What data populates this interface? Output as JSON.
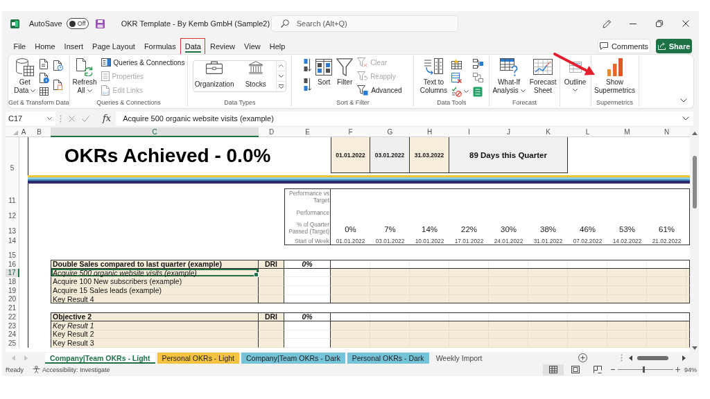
{
  "title_bar": {
    "autosave_label": "AutoSave",
    "autosave": {
      "label": "Off",
      "on": false
    },
    "document_title": "OKR Template - By Kemb GmbH (Sample2)",
    "search": {
      "placeholder": "Search (Alt+Q)"
    }
  },
  "menu": {
    "tabs": [
      {
        "label": "File",
        "selected": false,
        "outlined": false
      },
      {
        "label": "Home",
        "selected": false,
        "outlined": false
      },
      {
        "label": "Insert",
        "selected": false,
        "outlined": false
      },
      {
        "label": "Page Layout",
        "selected": false,
        "outlined": false
      },
      {
        "label": "Formulas",
        "selected": false,
        "outlined": false
      },
      {
        "label": "Data",
        "selected": true,
        "outlined": true
      },
      {
        "label": "Review",
        "selected": false,
        "outlined": false
      },
      {
        "label": "View",
        "selected": false,
        "outlined": false
      },
      {
        "label": "Help",
        "selected": false,
        "outlined": false
      }
    ],
    "comments": "Comments",
    "share": "Share"
  },
  "ribbon": {
    "pointer_arrow": true,
    "groups": [
      {
        "label": "Get & Transform Data",
        "columns": [
          [
            {
              "kind": "large",
              "label": "Get\nData",
              "dropdown": true
            }
          ],
          [
            {
              "kind": "icon"
            },
            {
              "kind": "icon"
            },
            {
              "kind": "icon"
            }
          ],
          [
            {
              "kind": "icon"
            },
            {
              "kind": "icon"
            }
          ]
        ]
      },
      {
        "label": "Queries & Connections",
        "columns": [
          [
            {
              "kind": "large",
              "label": "Refresh\nAll",
              "dropdown": true
            }
          ],
          [
            {
              "kind": "small",
              "label": "Queries & Connections",
              "disabled": false
            },
            {
              "kind": "small",
              "label": "Properties",
              "disabled": true
            },
            {
              "kind": "small",
              "label": "Edit Links",
              "disabled": true
            }
          ]
        ]
      },
      {
        "label": "Data Types",
        "columns": [
          [
            {
              "kind": "gallery",
              "items": [
                "Organization",
                "Stocks"
              ]
            }
          ]
        ]
      },
      {
        "label": "Sort & Filter",
        "columns": [
          [
            {
              "kind": "icon"
            },
            {
              "kind": "icon"
            }
          ],
          [
            {
              "kind": "large",
              "label": "Sort"
            }
          ],
          [
            {
              "kind": "large",
              "label": "Filter"
            }
          ],
          [
            {
              "kind": "small",
              "label": "Clear",
              "disabled": true
            },
            {
              "kind": "small",
              "label": "Reapply",
              "disabled": true
            },
            {
              "kind": "small",
              "label": "Advanced",
              "disabled": false
            }
          ]
        ]
      },
      {
        "label": "Data Tools",
        "columns": [
          [
            {
              "kind": "large",
              "label": "Text to\nColumns"
            }
          ],
          [
            {
              "kind": "icon"
            },
            {
              "kind": "icon"
            },
            {
              "kind": "icon",
              "dropdown": true
            }
          ],
          [
            {
              "kind": "icon"
            },
            {
              "kind": "icon"
            },
            {
              "kind": "icon"
            }
          ]
        ]
      },
      {
        "label": "Forecast",
        "columns": [
          [
            {
              "kind": "large",
              "label": "What-If\nAnalysis",
              "dropdown": true
            }
          ],
          [
            {
              "kind": "large",
              "label": "Forecast\nSheet"
            }
          ]
        ]
      },
      {
        "columns": [
          [
            {
              "kind": "large",
              "label": "Outline",
              "dropdown": true
            }
          ]
        ]
      },
      {
        "label": "Supermetrics",
        "columns": [
          [
            {
              "kind": "large",
              "label": "Show\nSupermetrics"
            }
          ]
        ]
      }
    ]
  },
  "formula_bar": {
    "name_box": "C17",
    "function_label": "fx",
    "value": "Acquire 500 organic website visits (example)"
  },
  "sheet": {
    "columns": [
      {
        "label": "A",
        "selected": false
      },
      {
        "label": "B",
        "selected": false
      },
      {
        "label": "C",
        "selected": true
      },
      {
        "label": "D",
        "selected": false
      },
      {
        "label": "E",
        "selected": false
      },
      {
        "label": "F",
        "selected": false
      },
      {
        "label": "G",
        "selected": false
      },
      {
        "label": "H",
        "selected": false
      },
      {
        "label": "I",
        "selected": false
      },
      {
        "label": "J",
        "selected": false
      },
      {
        "label": "K",
        "selected": false
      },
      {
        "label": "L",
        "selected": false
      },
      {
        "label": "M",
        "selected": false
      },
      {
        "label": "N",
        "selected": false
      }
    ],
    "rows": [
      {
        "kind": "banner",
        "header": "5",
        "title": "OKRs Achieved - 0.0%",
        "dates": [
          {
            "text": "01.01.2022",
            "color": "#f6eedb"
          },
          {
            "text": "03.01.2022",
            "color": "#efefef"
          },
          {
            "text": "31.03.2022",
            "color": "#f6eedb"
          }
        ],
        "days": "89 Days this Quarter"
      },
      {
        "kind": "divider"
      },
      {
        "kind": "metric",
        "header": "11",
        "label": "Performance vs Target"
      },
      {
        "kind": "metric",
        "header": "12",
        "label": "Performance"
      },
      {
        "kind": "metric",
        "header": "13",
        "label": "% of Quarter Passed (Target)",
        "values": [
          "0%",
          "7%",
          "14%",
          "22%",
          "30%",
          "38%",
          "46%",
          "53%",
          "61%"
        ]
      },
      {
        "kind": "week",
        "header": "14",
        "label": "Start of Week",
        "values": [
          "01.01.2022",
          "03.01.2022",
          "10.01.2022",
          "17.01.2022",
          "24.01.2022",
          "31.01.2022",
          "07.02.2022",
          "14.02.2022",
          "21.02.2022"
        ]
      },
      {
        "kind": "blank",
        "header": "15"
      },
      {
        "kind": "objective",
        "header": "16",
        "title": "Double Sales compared to last quarter (example)",
        "owner": "DRI",
        "progress": "0%"
      },
      {
        "kind": "key_result",
        "header": "17",
        "text": "Acquire 500 organic website visits (example)",
        "italic": true,
        "selected": true
      },
      {
        "kind": "key_result",
        "header": "18",
        "text": "Acquire 100 New subscribers (example)",
        "italic": false,
        "selected": false
      },
      {
        "kind": "key_result",
        "header": "19",
        "text": "Acquire 15 Sales leads (example)",
        "italic": false,
        "selected": false
      },
      {
        "kind": "key_result",
        "header": "20",
        "text": "Key Result 4",
        "italic": false,
        "selected": false
      },
      {
        "kind": "blank",
        "header": "21"
      },
      {
        "kind": "objective",
        "header": "22",
        "title": "Objective 2",
        "owner": "DRI",
        "progress": "0%"
      },
      {
        "kind": "key_result",
        "header": "23",
        "text": "Key Result 1",
        "italic": true,
        "selected": false
      },
      {
        "kind": "key_result",
        "header": "24",
        "text": "Key Result 2",
        "italic": false,
        "selected": false
      },
      {
        "kind": "key_result",
        "header": "25",
        "text": "Key Result 3",
        "italic": false,
        "selected": false
      }
    ]
  },
  "sheet_tabs": [
    {
      "label": "Company|Team OKRs - Light",
      "selected": true
    },
    {
      "label": "Personal OKRs - Light",
      "selected": false,
      "color": "#f5c342"
    },
    {
      "label": "Company|Team OKRs - Dark",
      "selected": false,
      "color": "#74c3d9"
    },
    {
      "label": "Personal OKRs - Dark",
      "selected": false,
      "color": "#74c3d9"
    },
    {
      "label": "Weekly Import",
      "selected": false
    }
  ],
  "status_bar": {
    "status": "Ready",
    "accessibility": "Accessibility: Investigate",
    "views": [
      {
        "selected": true
      },
      {
        "selected": false
      },
      {
        "selected": false
      }
    ],
    "zoom": {
      "level": 0.47,
      "label": "94%"
    }
  }
}
